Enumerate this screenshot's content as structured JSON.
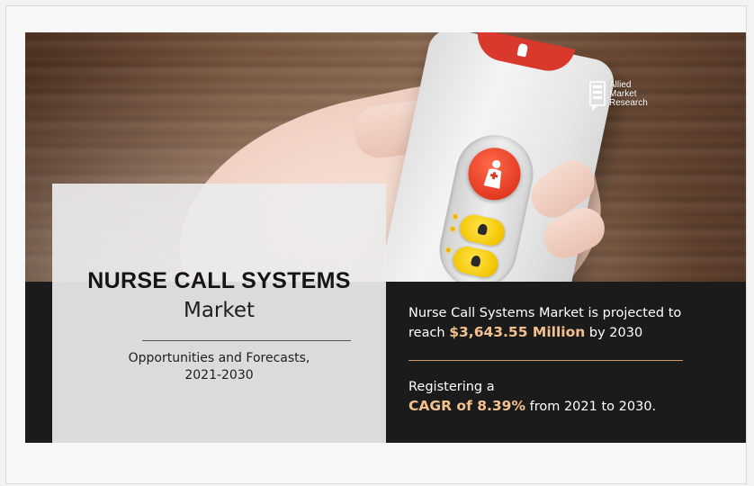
{
  "brand": {
    "logo_lines": [
      "Allied",
      "Market",
      "Research"
    ]
  },
  "title_card": {
    "title": "NURSE CALL SYSTEMS",
    "subtitle": "Market",
    "desc_line1": "Opportunities and Forecasts,",
    "desc_line2": "2021-2030"
  },
  "info": {
    "line1a": "Nurse Call Systems Market is projected to",
    "line1b_pre": "reach ",
    "line1b_hl": "$3,643.55 Million",
    "line1b_post": " by 2030",
    "line2a": "Registering a",
    "line2b_hl": "CAGR of 8.39%",
    "line2b_post": " from 2021 to 2030."
  },
  "colors": {
    "accent": "#f3c18f",
    "dark_band": "#1b1b1b",
    "device_red": "#d9392c",
    "button_yellow": "#f2c500"
  }
}
